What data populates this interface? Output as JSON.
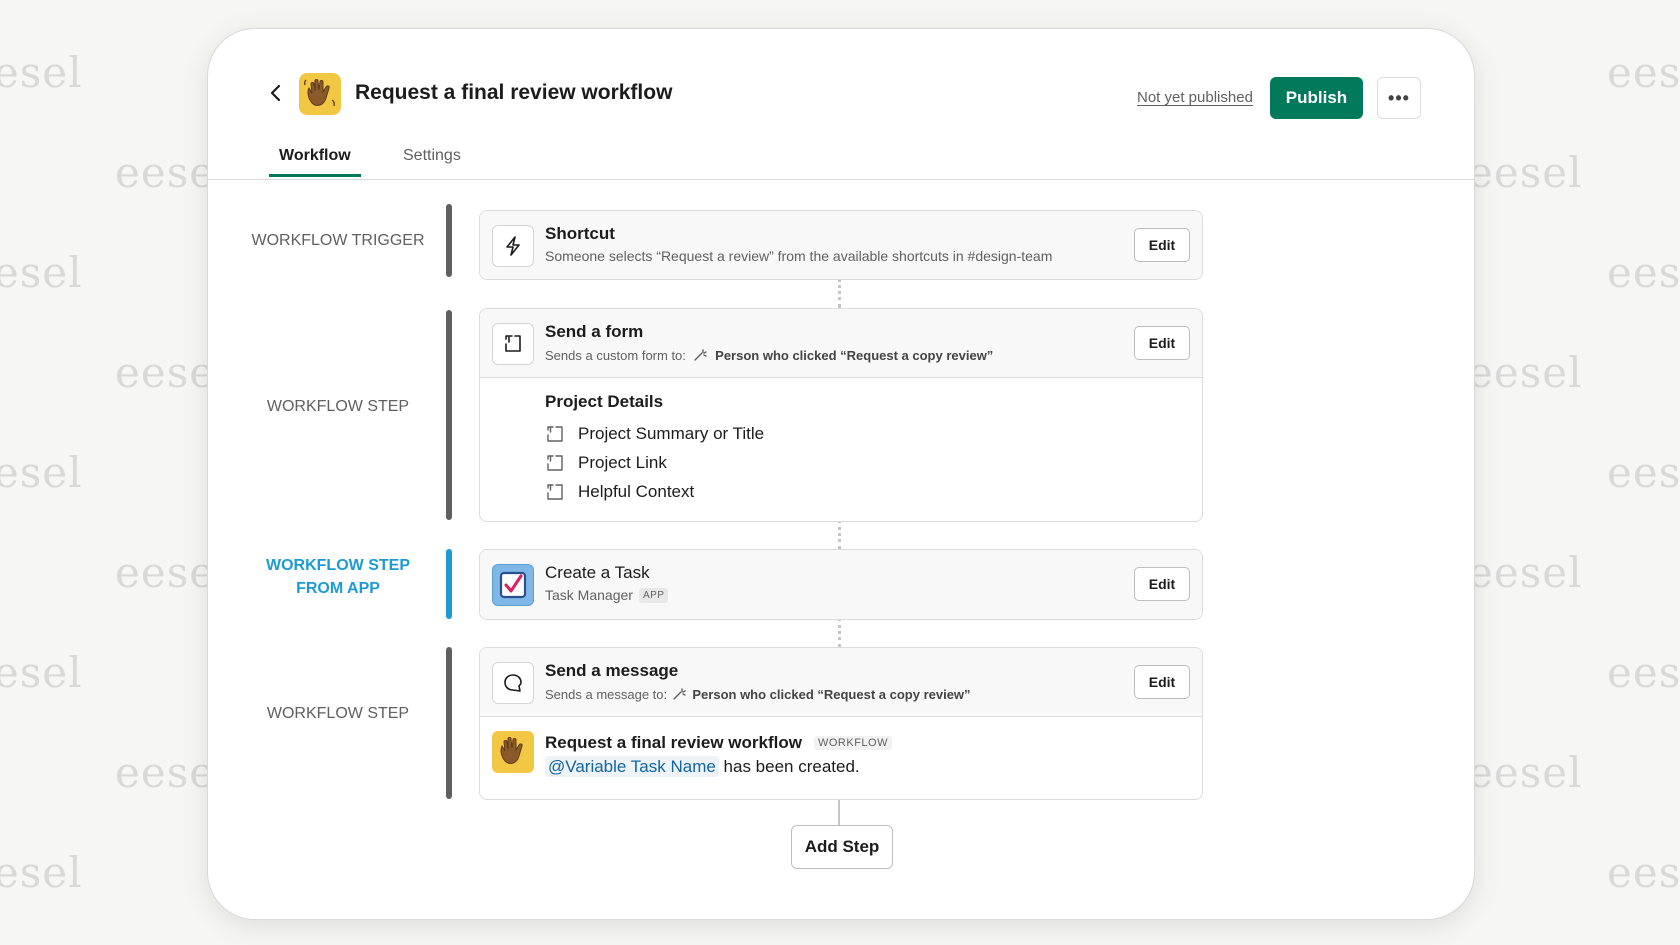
{
  "watermark": "eesel",
  "header": {
    "title": "Request a final review workflow",
    "status": "Not yet published",
    "publish_label": "Publish",
    "more_label": "•••"
  },
  "tabs": [
    {
      "label": "Workflow",
      "active": true
    },
    {
      "label": "Settings",
      "active": false
    }
  ],
  "sections": {
    "trigger_label": "WORKFLOW TRIGGER",
    "step_label": "WORKFLOW STEP",
    "app_step_label_line1": "WORKFLOW STEP",
    "app_step_label_line2": "FROM APP",
    "step_label_2": "WORKFLOW STEP"
  },
  "steps": {
    "shortcut": {
      "icon": "lightning-icon",
      "title": "Shortcut",
      "subtitle": "Someone selects “Request a review” from the available shortcuts in #design-team",
      "edit_label": "Edit"
    },
    "form": {
      "icon": "form-icon",
      "title": "Send a form",
      "subtitle_prefix": "Sends a custom form to:",
      "subtitle_target": "Person who clicked “Request a copy review”",
      "edit_label": "Edit",
      "form_title": "Project Details",
      "fields": [
        "Project Summary or Title",
        "Project Link",
        "Helpful Context"
      ]
    },
    "task": {
      "icon": "task-checkbox-icon",
      "title": "Create a Task",
      "app_name": "Task Manager",
      "app_badge": "APP",
      "edit_label": "Edit"
    },
    "message": {
      "icon": "message-bubble-icon",
      "title": "Send a message",
      "subtitle_prefix": "Sends a message to:",
      "subtitle_target": "Person who clicked “Request a copy review”",
      "edit_label": "Edit",
      "preview_title": "Request a final review workflow",
      "preview_badge": "WORKFLOW",
      "preview_variable": "@Variable Task Name",
      "preview_text": "has been created."
    }
  },
  "add_step_label": "Add Step",
  "colors": {
    "brand_green": "#007a5a",
    "app_blue": "#1d9bd1",
    "link_blue": "#1264a3",
    "avatar_yellow": "#f2c744"
  }
}
